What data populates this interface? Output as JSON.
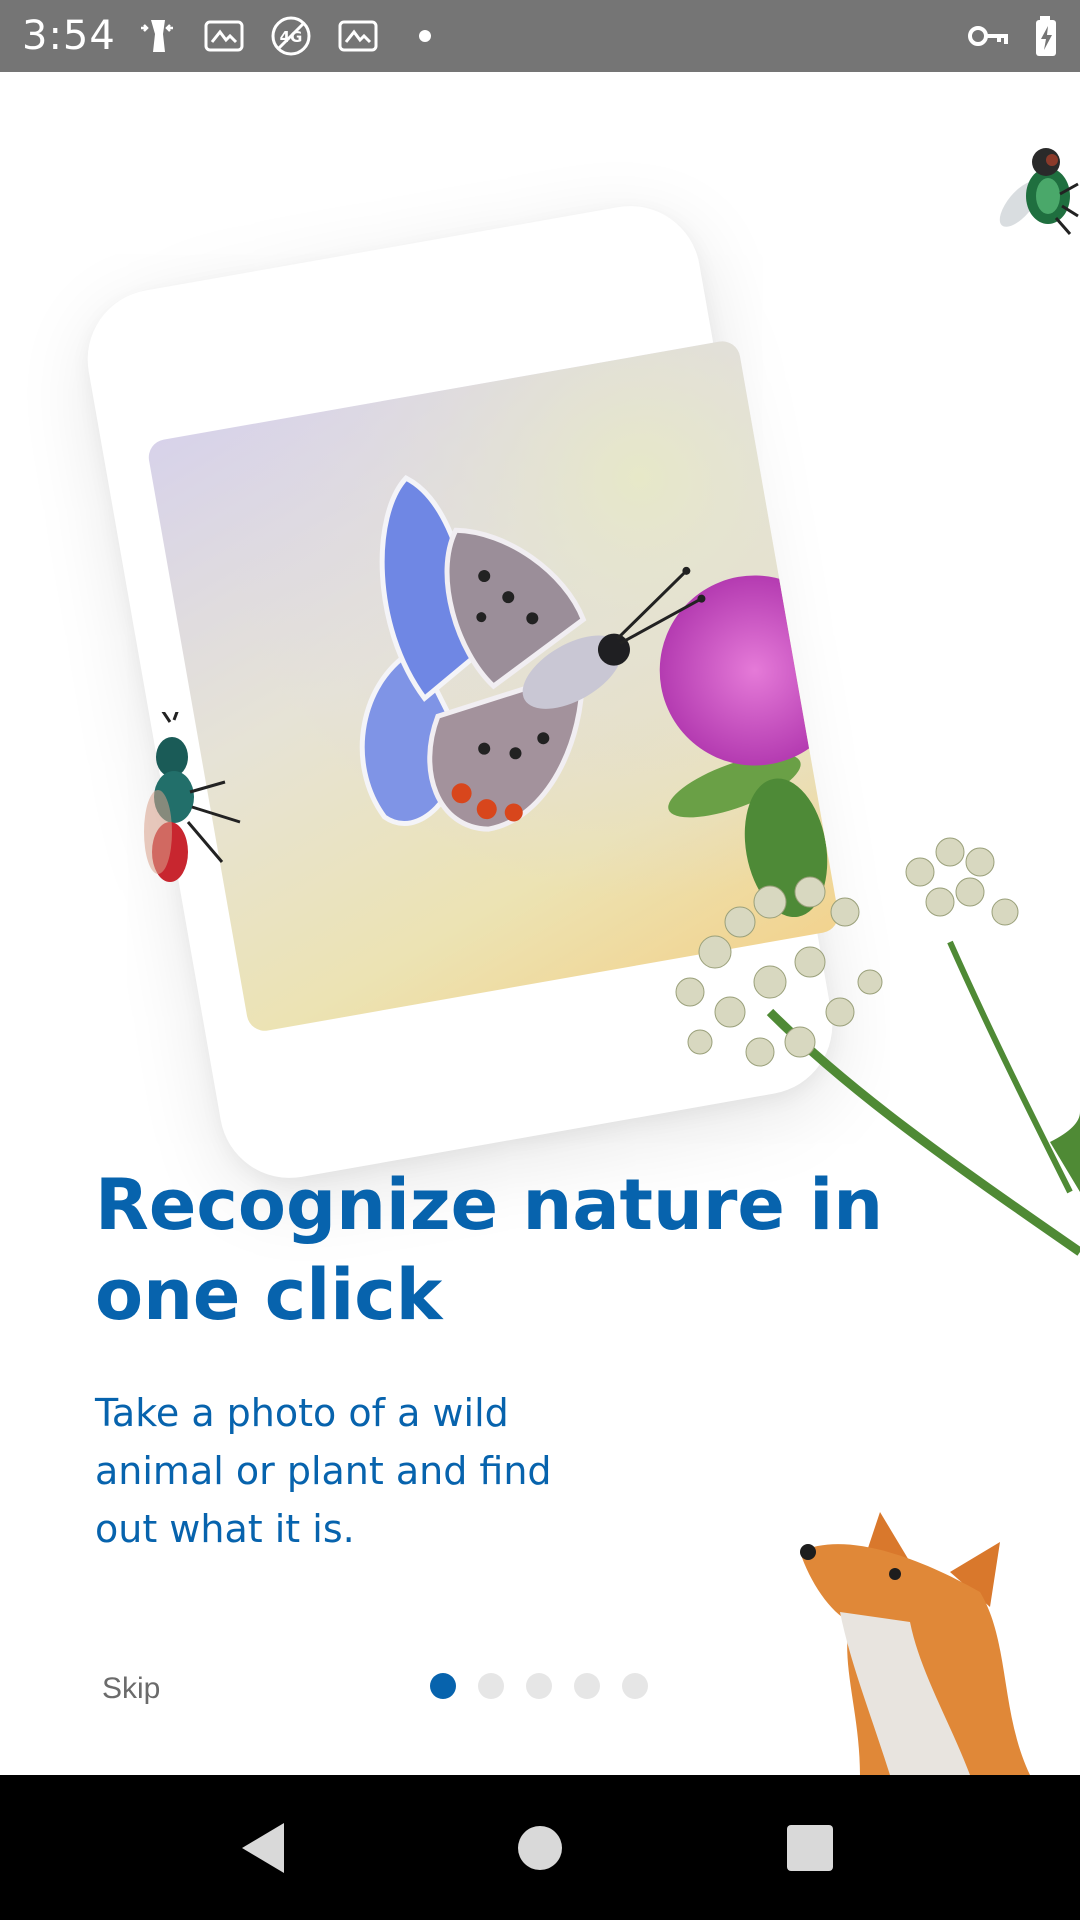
{
  "status_bar": {
    "time": "3:54",
    "left_icons": [
      "figure-icon",
      "photo-icon",
      "no-4g-icon",
      "photo-icon",
      "dot-icon"
    ],
    "right_icons": [
      "vpn-key-icon",
      "battery-charging-icon"
    ]
  },
  "onboarding": {
    "headline": "Recognize nature in one click",
    "description": "Take a photo of a wild animal or plant and find out what it is.",
    "skip_label": "Skip",
    "page_indicator": {
      "total": 5,
      "current": 1
    }
  },
  "colors": {
    "accent": "#0763ad",
    "status_bar_bg": "#757575",
    "nav_bar_bg": "#000000",
    "inactive_dot": "#e6e6e6"
  },
  "nav_bar": {
    "buttons": [
      "back-icon",
      "home-icon",
      "recents-icon"
    ]
  }
}
